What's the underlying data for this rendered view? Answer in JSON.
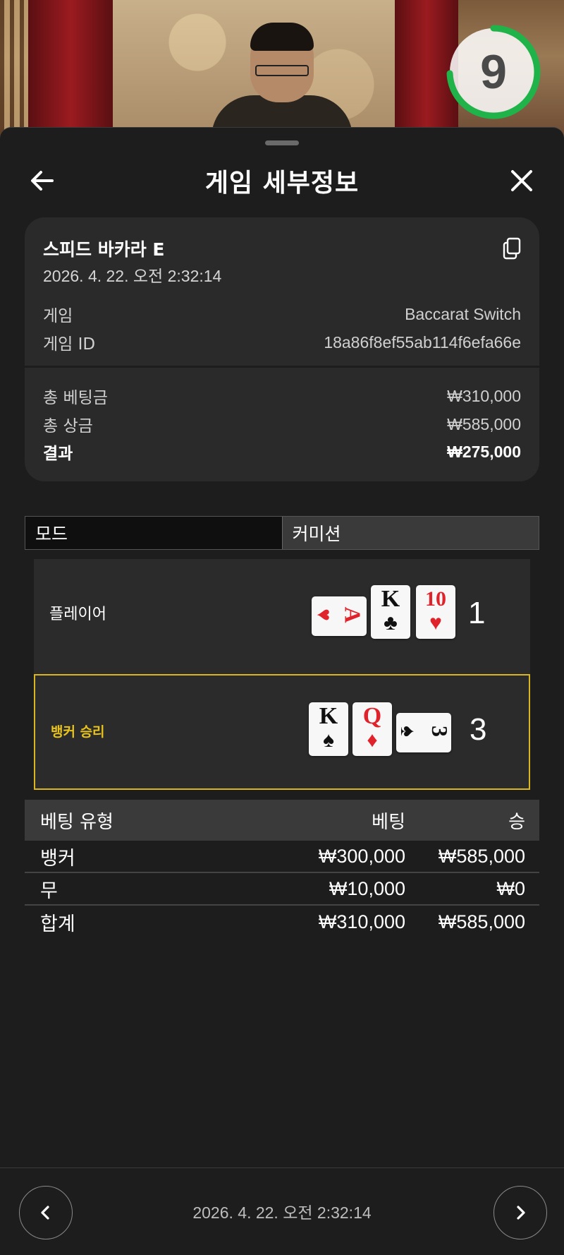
{
  "video": {
    "timer_value": "9",
    "timer_color": "#1fb34a"
  },
  "header": {
    "title": "게임 세부정보",
    "back_icon": "arrow-left-icon",
    "close_icon": "close-icon"
  },
  "info": {
    "game_name": "스피드 바카라 E",
    "datetime": "2026. 4. 22. 오전 2:32:14",
    "copy_icon": "copy-icon",
    "game_label": "게임",
    "game_value": "Baccarat Switch",
    "id_label": "게임 ID",
    "id_value": "18a86f8ef55ab114f6efa66e",
    "total_bet_label": "총 베팅금",
    "total_bet_value": "₩310,000",
    "total_win_label": "총 상금",
    "total_win_value": "₩585,000",
    "result_label": "결과",
    "result_value": "₩275,000"
  },
  "tabs": {
    "mode": "모드",
    "commission": "커미션"
  },
  "hands": {
    "player": {
      "label": "플레이어",
      "score": "1",
      "cards": [
        {
          "rank": "A",
          "suit": "♥",
          "orientation": "horizontal"
        },
        {
          "rank": "K",
          "suit": "♣",
          "orientation": "vertical"
        },
        {
          "rank": "10",
          "suit": "♥",
          "orientation": "vertical"
        }
      ]
    },
    "banker": {
      "label": "뱅커 승리",
      "score": "3",
      "highlight_color": "#d9b520",
      "cards": [
        {
          "rank": "K",
          "suit": "♠",
          "orientation": "vertical"
        },
        {
          "rank": "Q",
          "suit": "♦",
          "orientation": "vertical"
        },
        {
          "rank": "3",
          "suit": "♠",
          "orientation": "horizontal"
        }
      ]
    }
  },
  "bets": {
    "headers": [
      "베팅 유형",
      "베팅",
      "승"
    ],
    "rows": [
      [
        "뱅커",
        "₩300,000",
        "₩585,000"
      ],
      [
        "무",
        "₩10,000",
        "₩0"
      ],
      [
        "합계",
        "₩310,000",
        "₩585,000"
      ]
    ]
  },
  "footer": {
    "datetime": "2026. 4. 22. 오전 2:32:14",
    "prev_icon": "chevron-left-icon",
    "next_icon": "chevron-right-icon"
  }
}
